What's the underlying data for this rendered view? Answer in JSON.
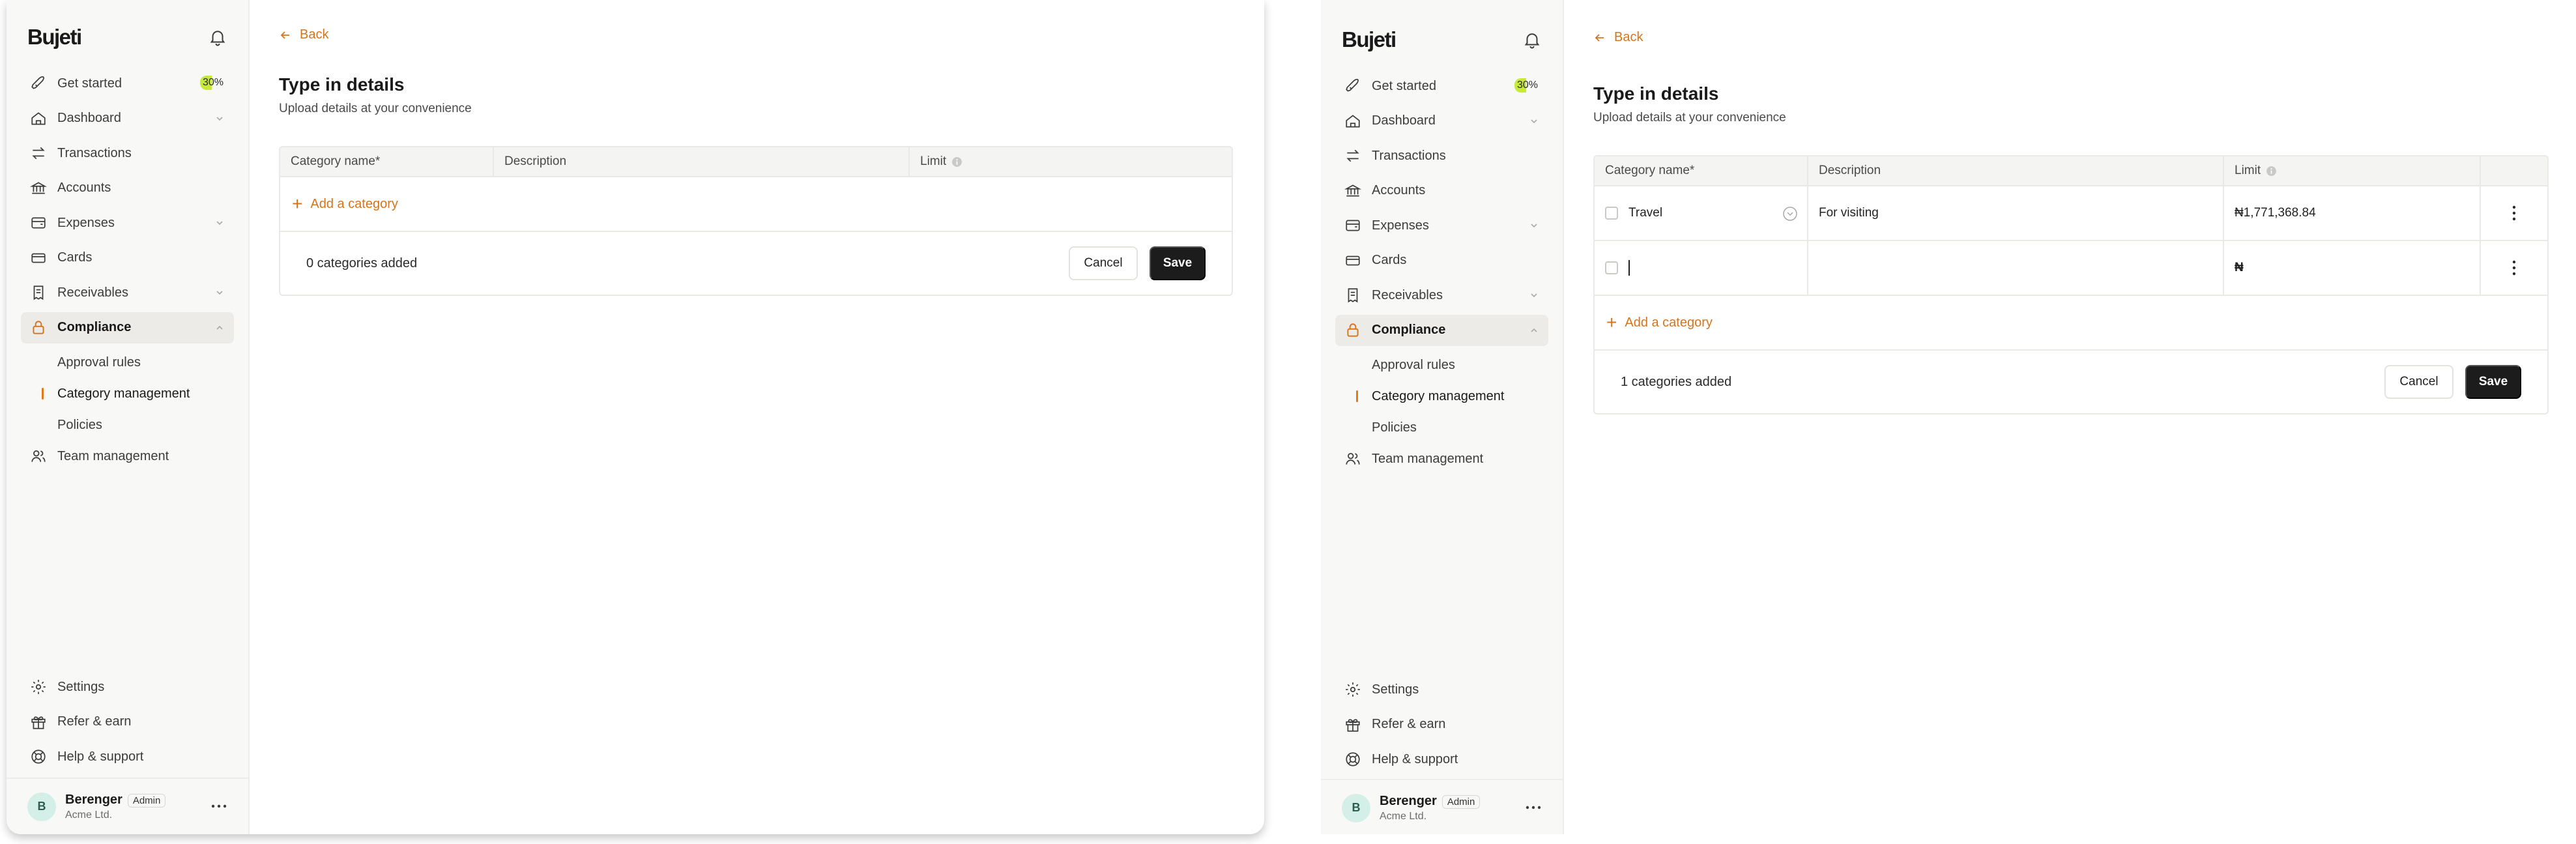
{
  "app": {
    "logo": "Bujeti"
  },
  "sidebar": {
    "get_started": "Get started",
    "progress": "30%",
    "items": [
      {
        "label": "Dashboard"
      },
      {
        "label": "Transactions"
      },
      {
        "label": "Accounts"
      },
      {
        "label": "Expenses"
      },
      {
        "label": "Cards"
      },
      {
        "label": "Receivables"
      },
      {
        "label": "Compliance"
      }
    ],
    "compliance_sub": [
      {
        "label": "Approval rules"
      },
      {
        "label": "Category management"
      },
      {
        "label": "Policies"
      }
    ],
    "team": "Team management",
    "bottom": [
      {
        "label": "Settings"
      },
      {
        "label": "Refer & earn"
      },
      {
        "label": "Help & support"
      }
    ],
    "user": {
      "initial": "B",
      "name": "Berenger",
      "role": "Admin",
      "company": "Acme Ltd."
    }
  },
  "main": {
    "back": "Back",
    "title": "Type in details",
    "subtitle": "Upload details at your convenience",
    "columns": [
      "Category name*",
      "Description",
      "Limit"
    ],
    "add_category": "Add a category",
    "cancel": "Cancel",
    "save": "Save"
  },
  "screen1": {
    "count_text": "0 categories added"
  },
  "screen2": {
    "rows": [
      {
        "name": "Travel",
        "description": "For visiting",
        "limit": "₦1,771,368.84"
      },
      {
        "name": "",
        "description": "",
        "limit": "₦"
      }
    ],
    "count_text": "1 categories added"
  },
  "icons": {
    "get_started": "rocket-icon",
    "dashboard": "home-icon",
    "transactions": "arrows-swap-icon",
    "accounts": "bank-icon",
    "expenses": "wallet-icon",
    "cards": "credit-card-icon",
    "receivables": "receipt-icon",
    "compliance": "lock-icon",
    "team": "users-icon",
    "settings": "gear-icon",
    "refer": "gift-icon",
    "help": "lifebuoy-icon",
    "bell": "bell-icon"
  },
  "colors": {
    "accent": "#d6741c",
    "primary_button": "#1c1c1c",
    "progress_highlight": "#c6e93c",
    "sidebar_bg": "#f8f8f6"
  }
}
